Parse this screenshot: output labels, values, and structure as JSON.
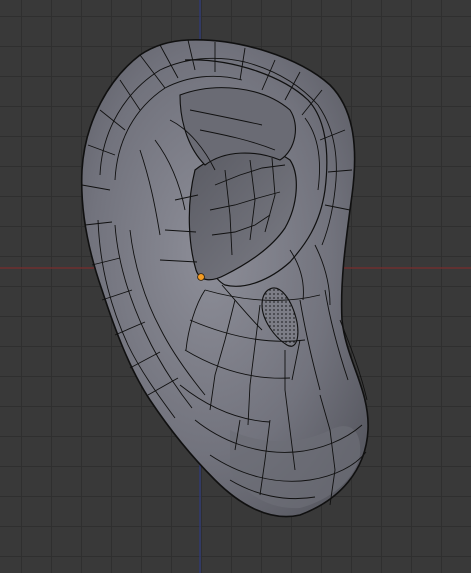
{
  "viewport": {
    "background": "#393939",
    "grid_color": "#2f2f2f",
    "axis_x_color": "#7a2d2d",
    "axis_y_color": "#2e3a7a"
  },
  "mesh": {
    "name": "ear-mesh",
    "face_color": "#7a7b85",
    "edge_color": "#101010",
    "shadow_color": "#4d4e56",
    "selected_vertex_color": "#f39c24",
    "icons": [
      "3d-cursor-icon"
    ]
  }
}
